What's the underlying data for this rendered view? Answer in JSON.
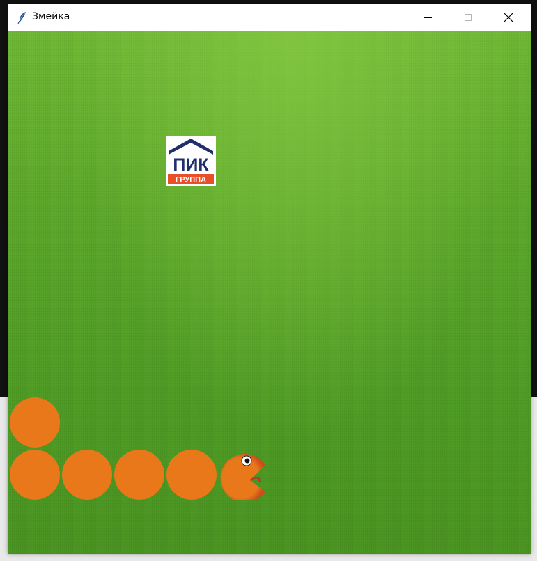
{
  "window": {
    "title": "Змейка",
    "app_icon": "feather-icon",
    "controls": [
      "minimize-icon",
      "maximize-icon",
      "close-icon"
    ]
  },
  "game": {
    "background": "grass",
    "food": {
      "type": "logo",
      "text_top": "ПИК",
      "text_bottom": "ГРУППА"
    },
    "snake": {
      "segments": 6,
      "head_direction": "right",
      "body_color": "#e8781a",
      "head_color": "#e8781a"
    }
  }
}
